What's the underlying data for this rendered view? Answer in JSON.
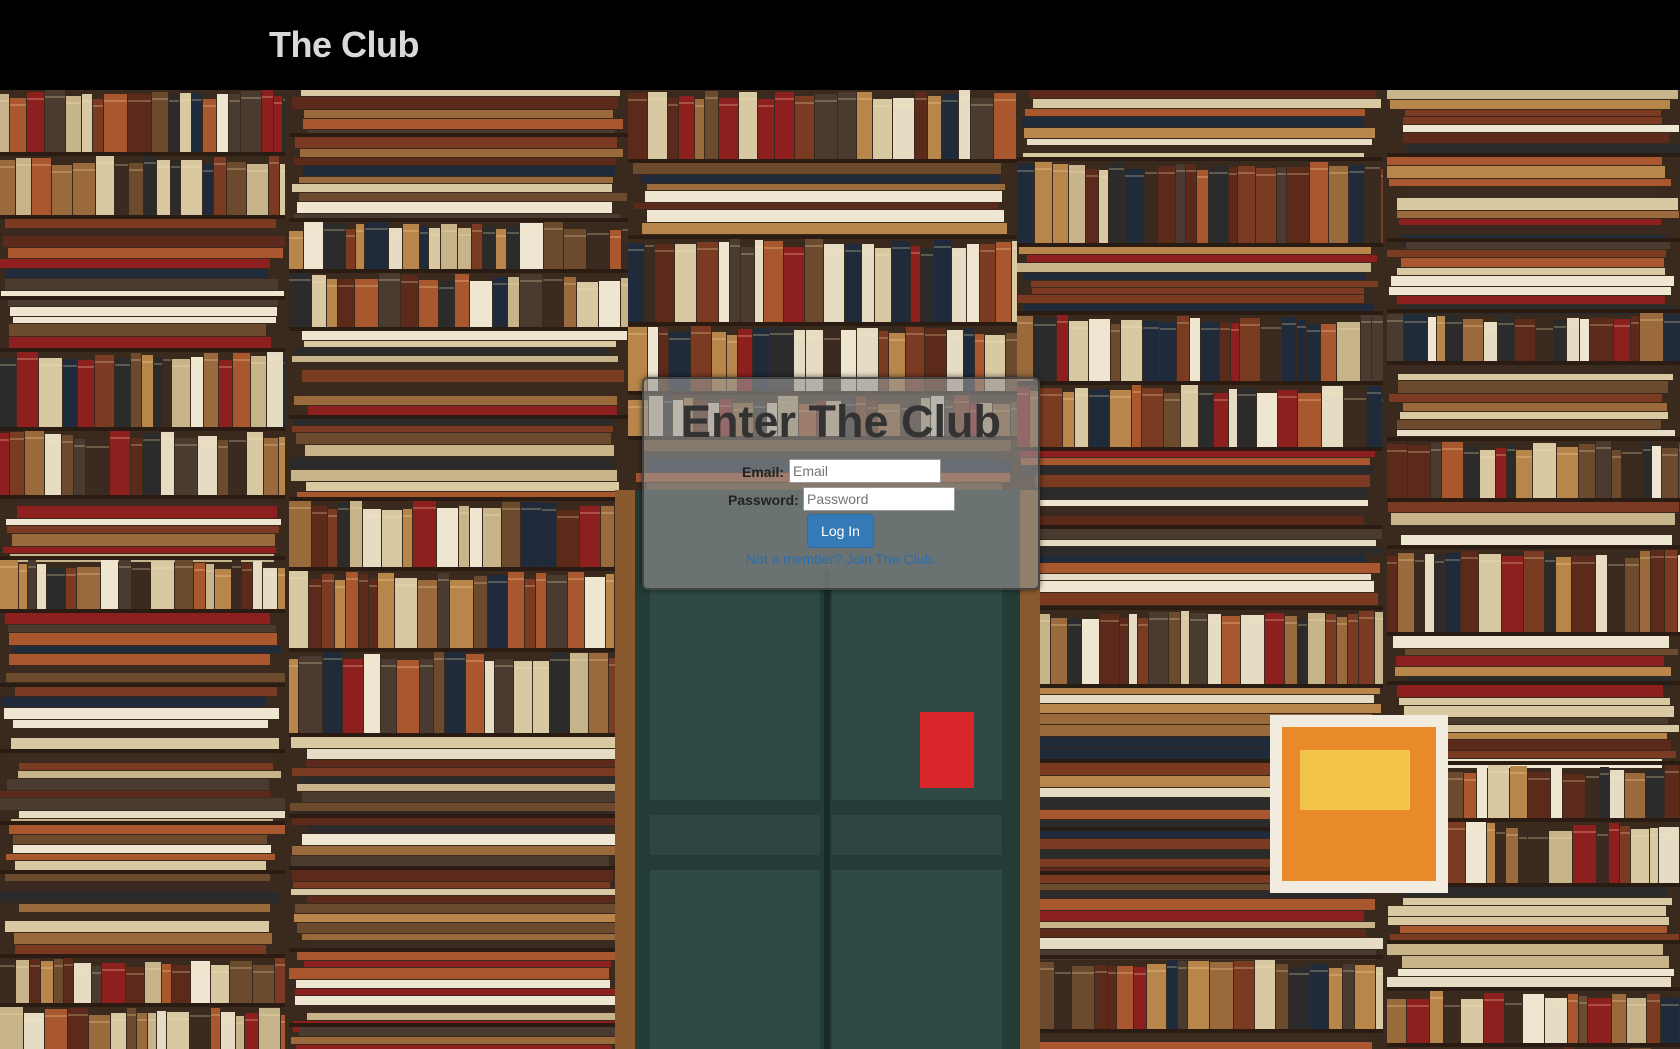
{
  "navbar": {
    "brand": "The Club"
  },
  "background": {
    "description_icon": "bookshelf-door-photo"
  },
  "login": {
    "title": "Enter The Club",
    "email_label": "Email:",
    "email_placeholder": "Email",
    "password_label": "Password:",
    "password_placeholder": "Password",
    "submit_label": "Log In",
    "signup_text": "Not a member? Join The Club."
  },
  "colors": {
    "navbar": "#000000",
    "button": "#337ab7",
    "link": "#2a6db0",
    "door": "#2f4a45"
  }
}
